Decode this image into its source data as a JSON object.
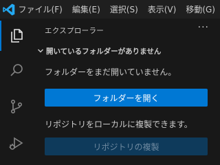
{
  "titlebar": {
    "menu": [
      "ファイル(F)",
      "編集(E)",
      "選択(S)",
      "表示(V)",
      "移動(G)"
    ]
  },
  "activity_bar": {
    "items": [
      {
        "icon": "files-icon",
        "active": true
      },
      {
        "icon": "search-icon",
        "active": false
      },
      {
        "icon": "source-control-icon",
        "active": false
      },
      {
        "icon": "run-debug-icon",
        "active": false
      }
    ]
  },
  "sidebar": {
    "header": "エクスプローラー",
    "more": "···",
    "section_title": "開いているフォルダーがありません",
    "message_open": "フォルダーをまだ開いていません。",
    "open_button": "フォルダーを開く",
    "message_clone": "リポジトリをローカルに複製できます。",
    "clone_button": "リポジトリの複製"
  },
  "colors": {
    "accent": "#0078d4",
    "logo": "#23a9f2",
    "background": "#181818",
    "text": "#cccccc"
  }
}
